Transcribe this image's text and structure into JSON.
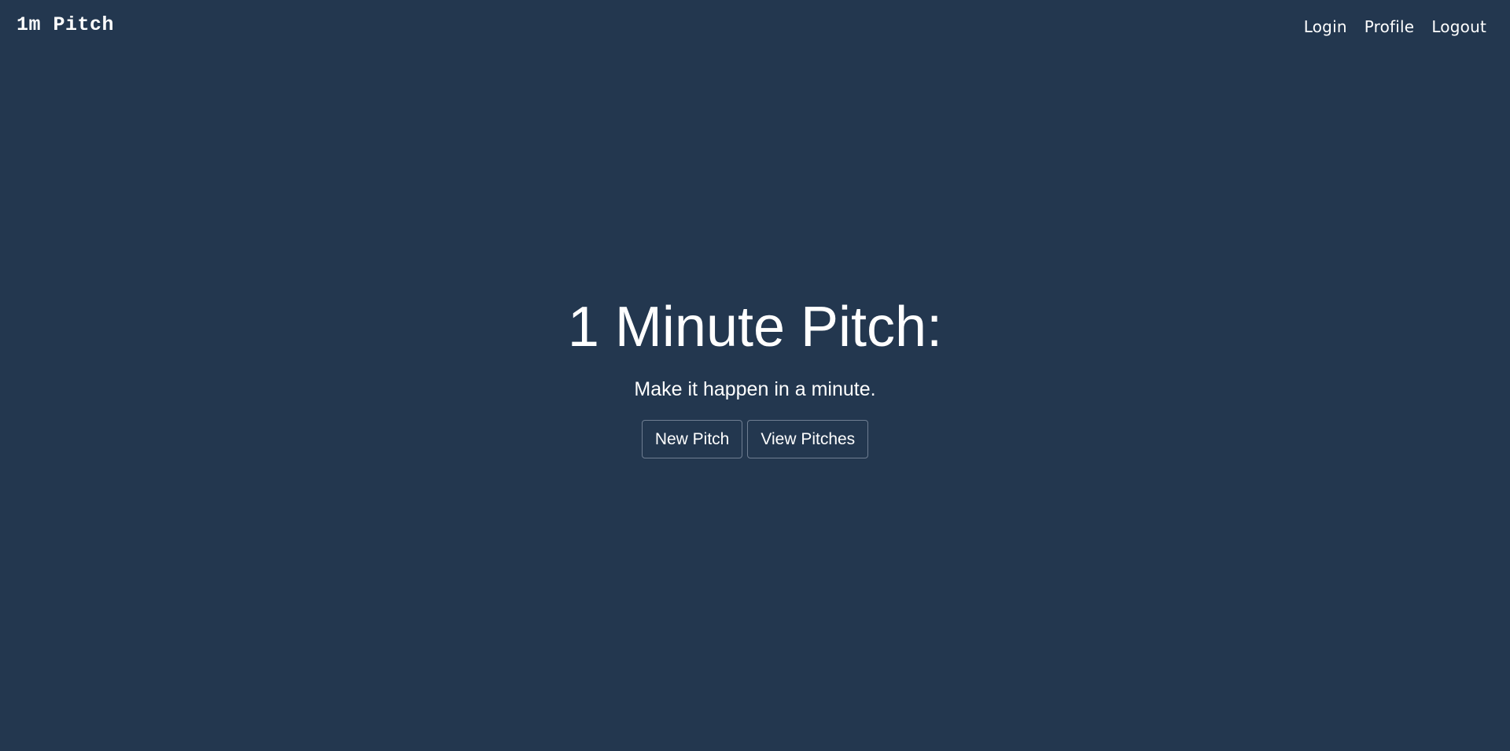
{
  "navbar": {
    "brand": "1m Pitch",
    "links": [
      "Login",
      "Profile",
      "Logout"
    ]
  },
  "hero": {
    "title": "1 Minute Pitch:",
    "subtitle": "Make it happen in a minute.",
    "buttons": [
      "New Pitch",
      "View Pitches"
    ]
  },
  "colors": {
    "background": "#23374f",
    "text": "#ffffff",
    "button_border": "#6f7e92"
  }
}
